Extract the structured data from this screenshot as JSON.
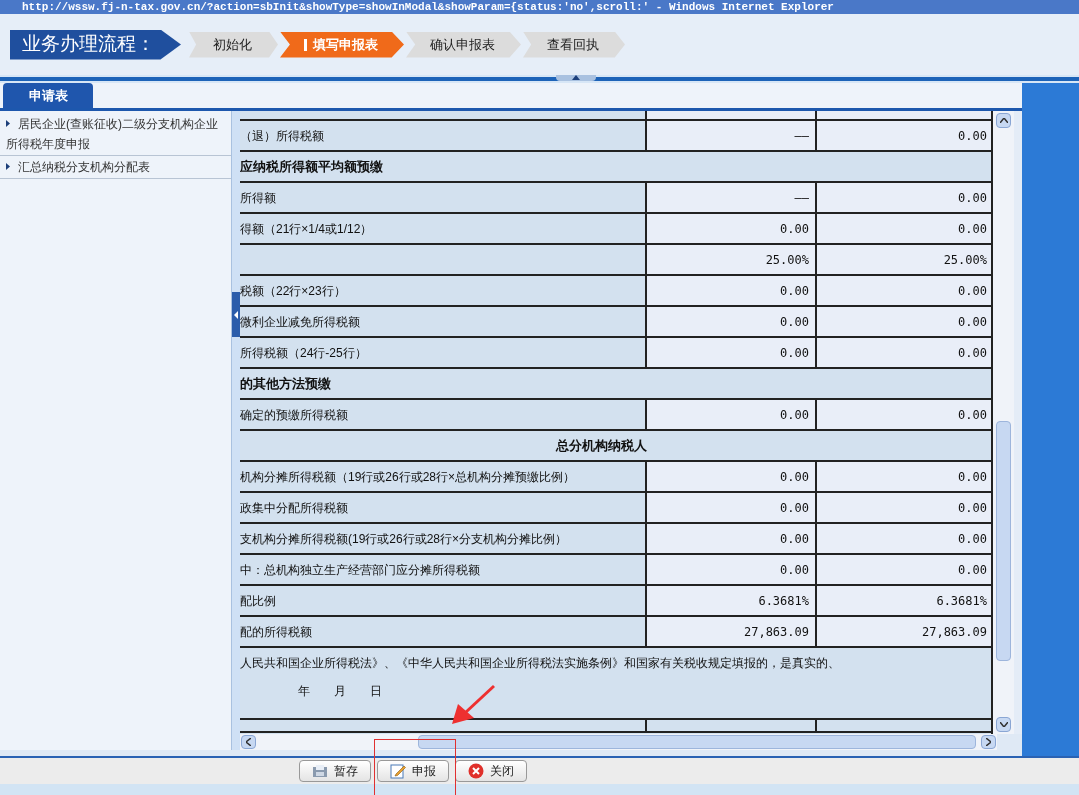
{
  "window": {
    "title": "http://wssw.fj-n-tax.gov.cn/?action=sbInit&showType=showInModal&showParam={status:'no',scroll:' - Windows Internet Explorer"
  },
  "process": {
    "label": "业务办理流程：",
    "steps": [
      {
        "label": "初始化",
        "selected": false
      },
      {
        "label": "填写申报表",
        "selected": true
      },
      {
        "label": "确认申报表",
        "selected": false
      },
      {
        "label": "查看回执",
        "selected": false
      }
    ]
  },
  "tabs": [
    {
      "label": "申请表",
      "selected": true
    }
  ],
  "sidebar": {
    "items": [
      {
        "label": "居民企业(查账征收)二级分支机构企业所得税年度申报"
      },
      {
        "label": "汇总纳税分支机构分配表"
      }
    ]
  },
  "table": {
    "rows": [
      {
        "kind": "row",
        "label": "（退）所得税额",
        "column_2": "——",
        "column_3": "0.00"
      },
      {
        "kind": "section",
        "label": "应纳税所得额平均额预缴"
      },
      {
        "kind": "row",
        "label": "所得额",
        "column_2": "——",
        "column_3": "0.00"
      },
      {
        "kind": "row",
        "label": "得额（21行×1/4或1/12）",
        "column_2": "0.00",
        "column_3": "0.00"
      },
      {
        "kind": "row",
        "column_2": "25.00%",
        "column_3": "25.00%"
      },
      {
        "kind": "row",
        "label": "税额（22行×23行）",
        "column_2": "0.00",
        "column_3": "0.00"
      },
      {
        "kind": "row",
        "label": "微利企业减免所得税额",
        "column_2": "0.00",
        "column_3": "0.00"
      },
      {
        "kind": "row",
        "label": "所得税额（24行-25行）",
        "column_2": "0.00",
        "column_3": "0.00"
      },
      {
        "kind": "section",
        "label": "的其他方法预缴"
      },
      {
        "kind": "row",
        "label": "确定的预缴所得税额",
        "column_2": "0.00",
        "column_3": "0.00"
      },
      {
        "kind": "heading",
        "label": "总分机构纳税人"
      },
      {
        "kind": "row",
        "label": "机构分摊所得税额（19行或26行或28行×总机构分摊预缴比例）",
        "column_2": "0.00",
        "column_3": "0.00"
      },
      {
        "kind": "row",
        "label": "政集中分配所得税额",
        "column_2": "0.00",
        "column_3": "0.00"
      },
      {
        "kind": "row",
        "label": "支机构分摊所得税额(19行或26行或28行×分支机构分摊比例）",
        "column_2": "0.00",
        "column_3": "0.00"
      },
      {
        "kind": "row",
        "label": "中：总机构独立生产经营部门应分摊所得税额",
        "column_2": "0.00",
        "column_3": "0.00"
      },
      {
        "kind": "row",
        "label": "配比例",
        "column_2": "6.3681%",
        "column_3": "6.3681%"
      },
      {
        "kind": "row",
        "label": "配的所得税额",
        "column_2": "27,863.09",
        "column_3": "27,863.09"
      },
      {
        "kind": "declaration",
        "label": "人民共和国企业所得税法》、《中华人民共和国企业所得税法实施条例》和国家有关税收规定填报的，是真实的、",
        "date": "年　　月　　日"
      }
    ]
  },
  "buttons": [
    {
      "kind": "save",
      "label": "暂存"
    },
    {
      "kind": "submit",
      "label": "申报"
    },
    {
      "kind": "close",
      "label": "关闭"
    }
  ]
}
